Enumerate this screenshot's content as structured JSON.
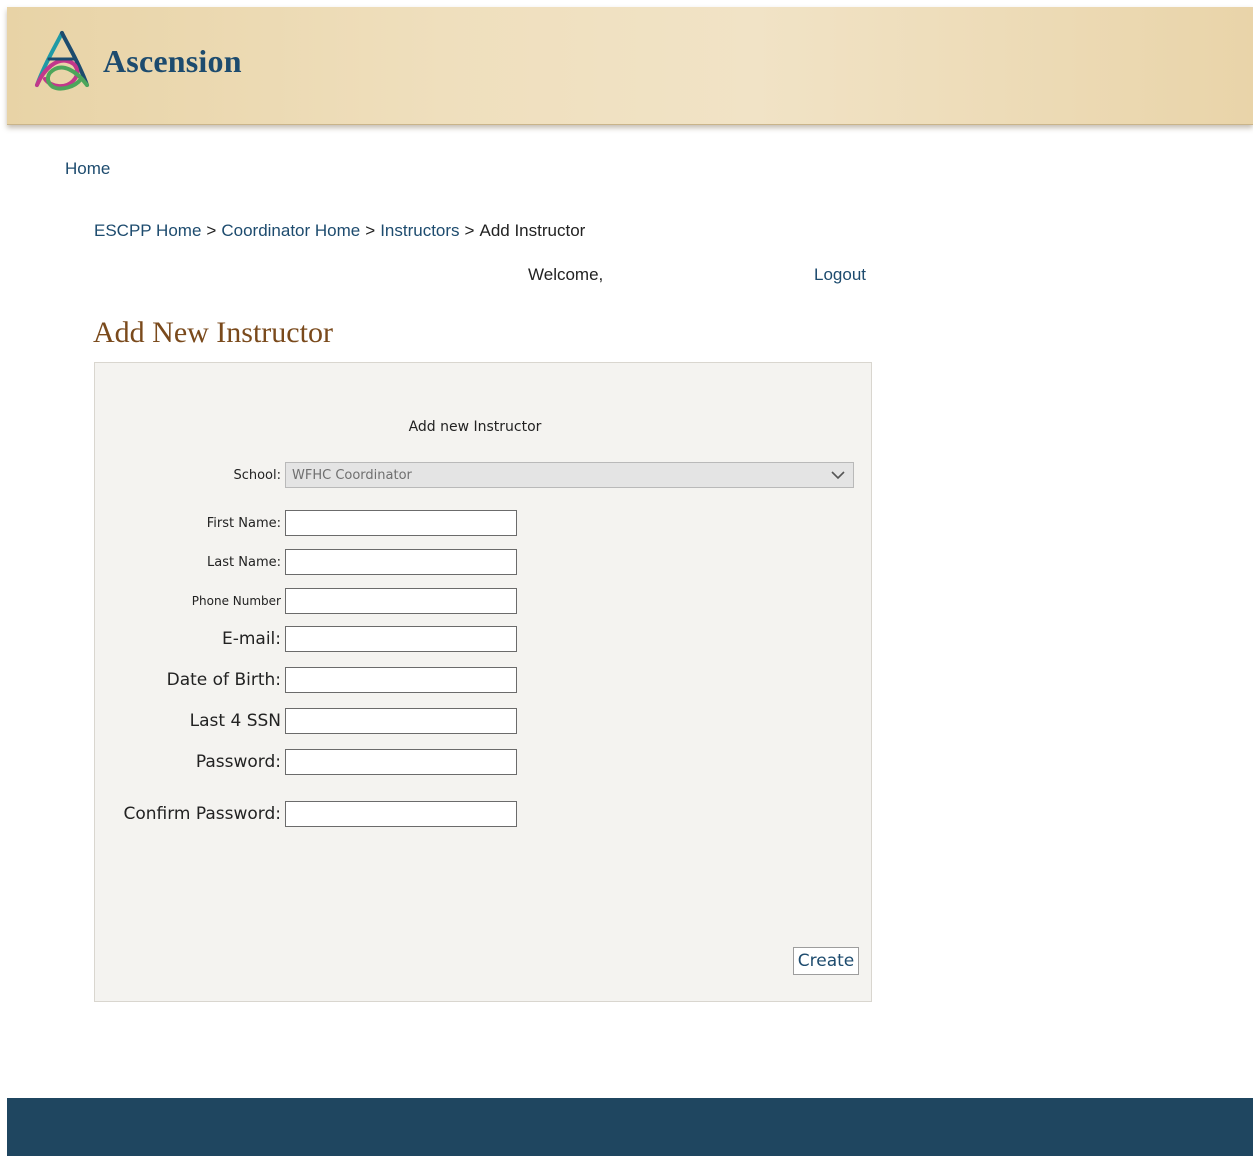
{
  "header": {
    "brand": "Ascension",
    "brand_colors": {
      "teal": "#1f9aa6",
      "magenta": "#c2388b",
      "green": "#4da65b",
      "navy": "#1d4b6e"
    }
  },
  "nav": {
    "home_label": "Home"
  },
  "breadcrumb": {
    "items": [
      "ESCPP Home",
      "Coordinator Home",
      "Instructors",
      "Add Instructor"
    ],
    "separator": ">"
  },
  "session": {
    "welcome_text": "Welcome,",
    "logout_label": "Logout"
  },
  "page": {
    "title": "Add New Instructor"
  },
  "form": {
    "heading": "Add new Instructor",
    "school_label": "School:",
    "school_value": "WFHC Coordinator",
    "fields": [
      {
        "label": "First Name:",
        "value": ""
      },
      {
        "label": "Last Name:",
        "value": ""
      },
      {
        "label": "Phone Number",
        "value": ""
      },
      {
        "label": "E-mail:",
        "value": ""
      },
      {
        "label": "Date of Birth:",
        "value": ""
      },
      {
        "label": "Last 4 SSN",
        "value": ""
      },
      {
        "label": "Password:",
        "value": ""
      },
      {
        "label": "Confirm Password:",
        "value": ""
      }
    ],
    "submit_label": "Create"
  },
  "colors": {
    "link": "#1d4b6e",
    "title": "#7a4a1c",
    "footer": "#1f4660",
    "panel": "#f4f3f0"
  }
}
